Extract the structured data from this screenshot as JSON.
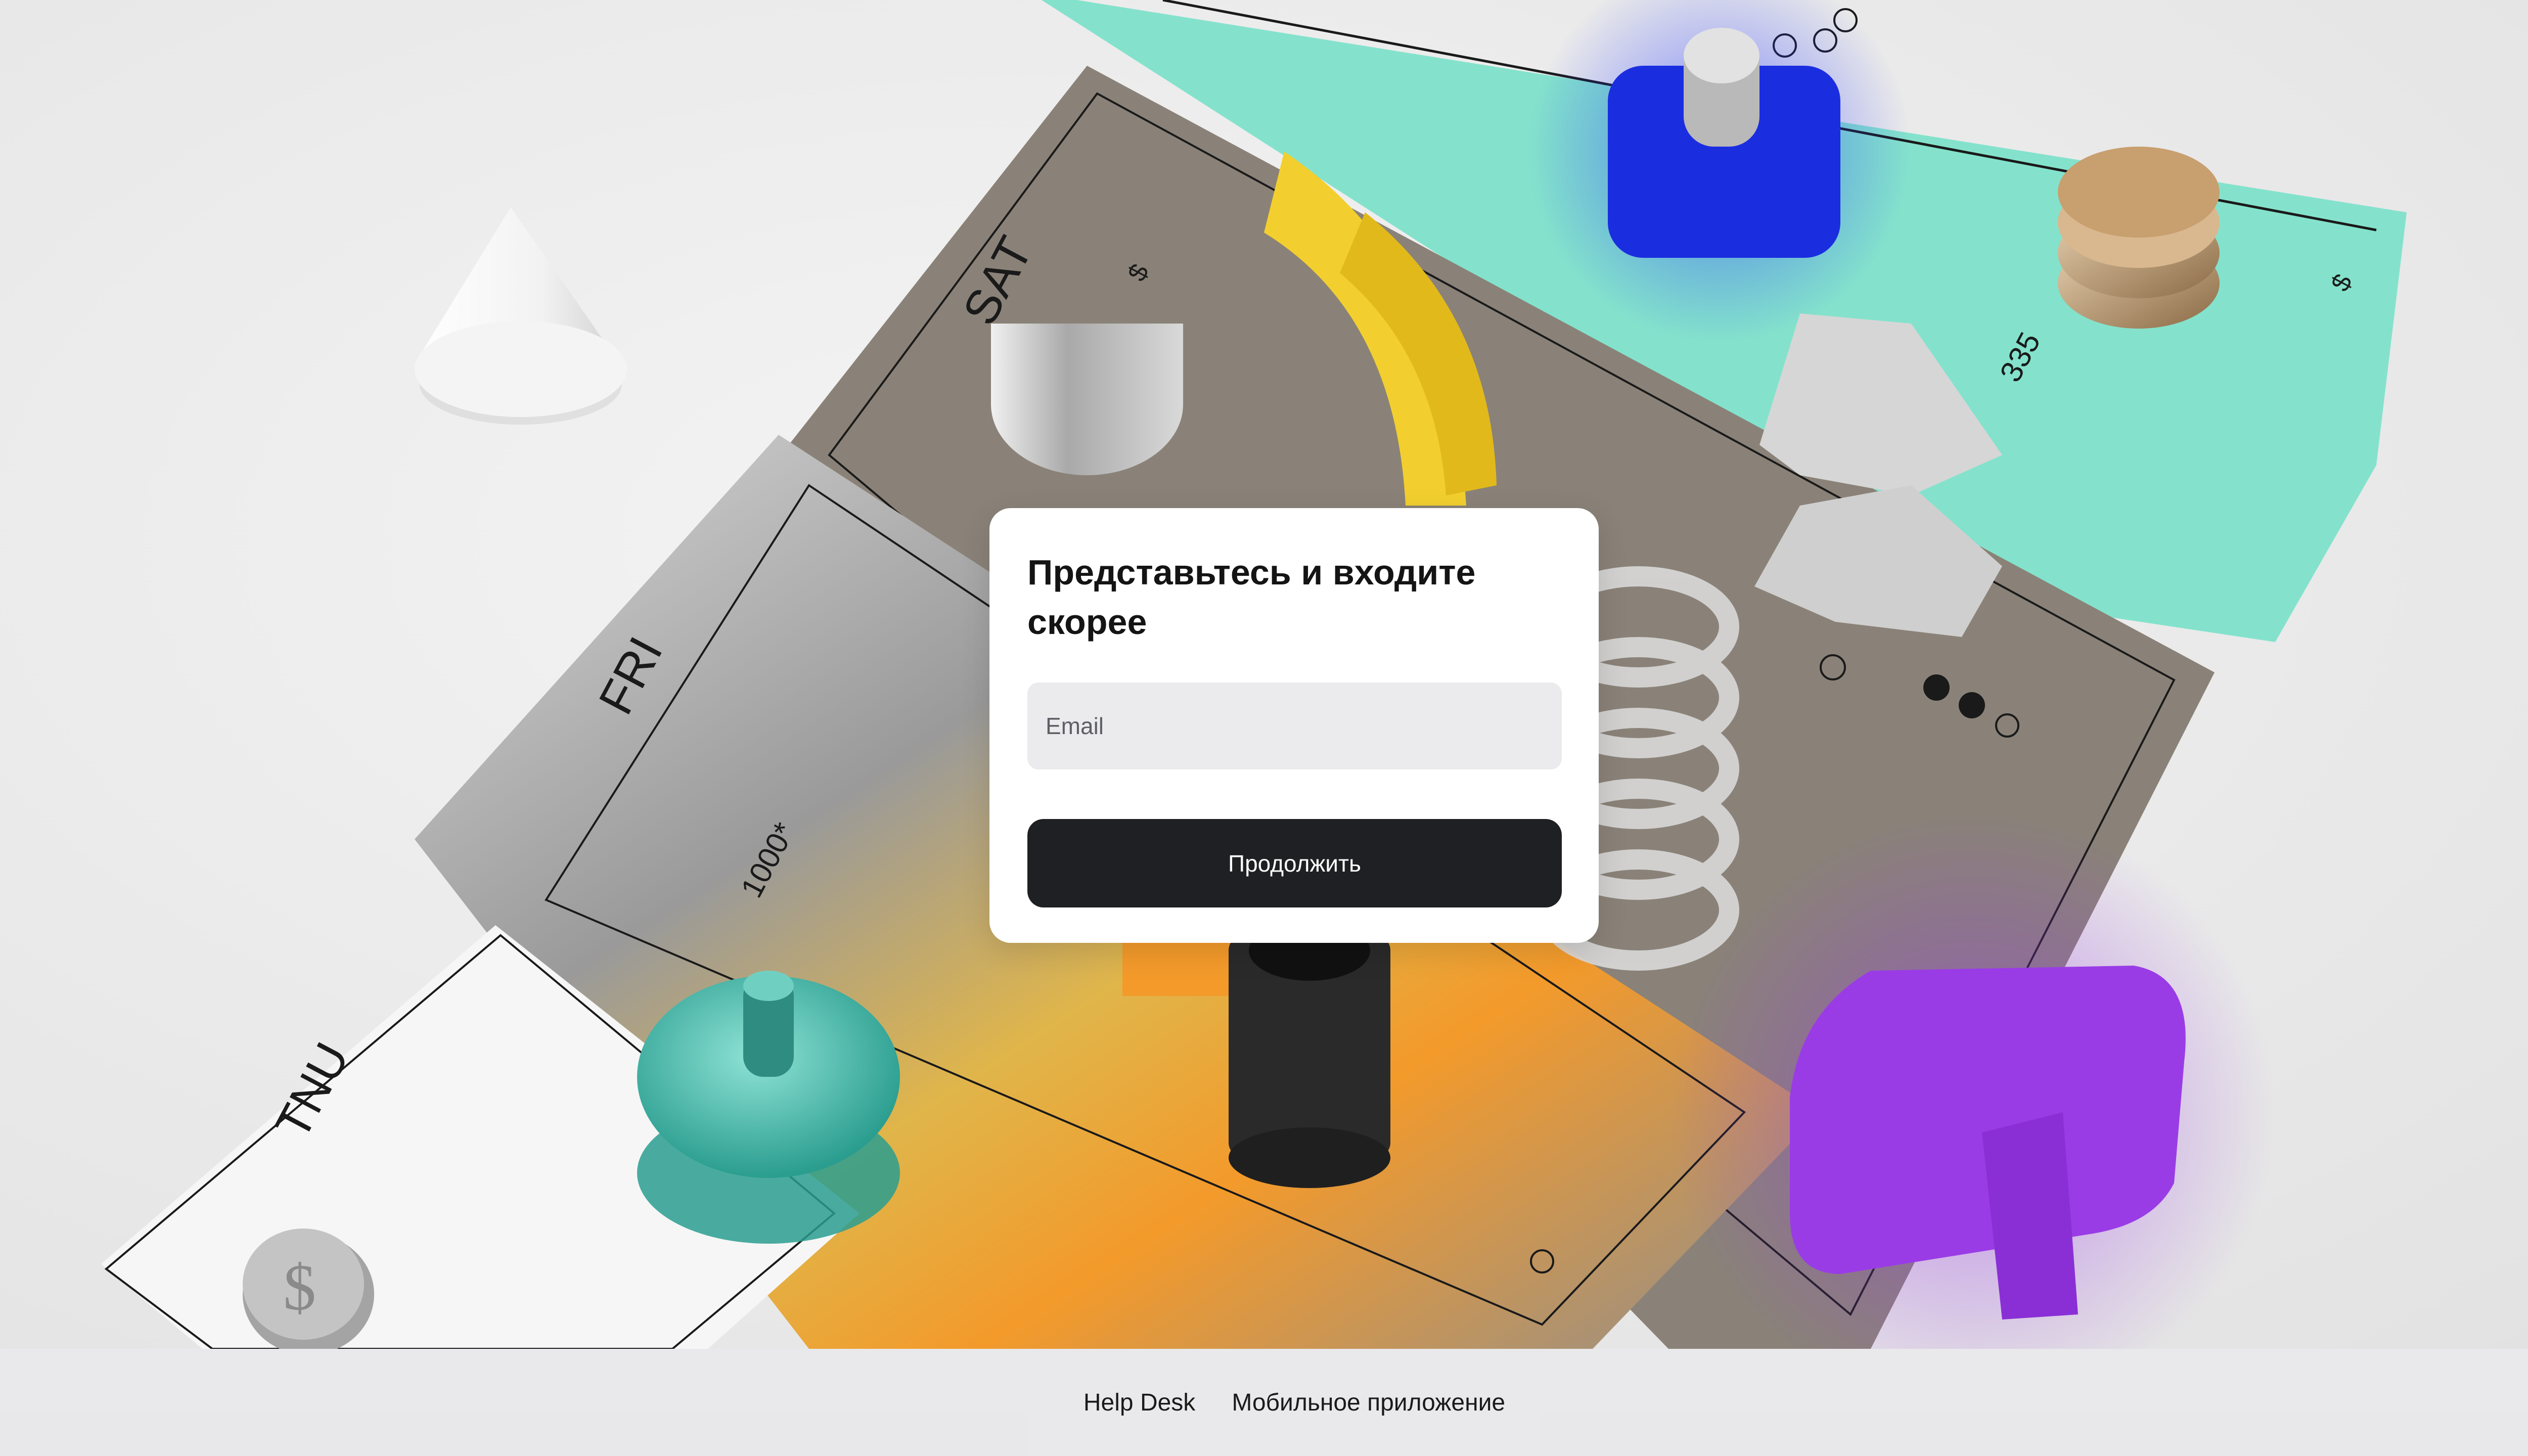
{
  "login": {
    "title": "Представьтесь и входите скорее",
    "email_placeholder": "Email",
    "continue_label": "Продолжить"
  },
  "footer": {
    "links": [
      {
        "label": "Help Desk"
      },
      {
        "label": "Мобильное приложение"
      }
    ]
  },
  "background": {
    "ticket_labels": [
      "SAT",
      "FRI",
      "TNU",
      "1000*",
      "335"
    ],
    "currency_symbol": "$",
    "accent_colors": {
      "mint": "#7fe0c8",
      "taupe": "#8a8278",
      "yellow": "#f2cf2e",
      "blue": "#1a2ee0",
      "purple": "#9a3ce6",
      "teal": "#3fb8a8",
      "orange": "#f39a2b",
      "gold": "#c59b6a"
    }
  }
}
